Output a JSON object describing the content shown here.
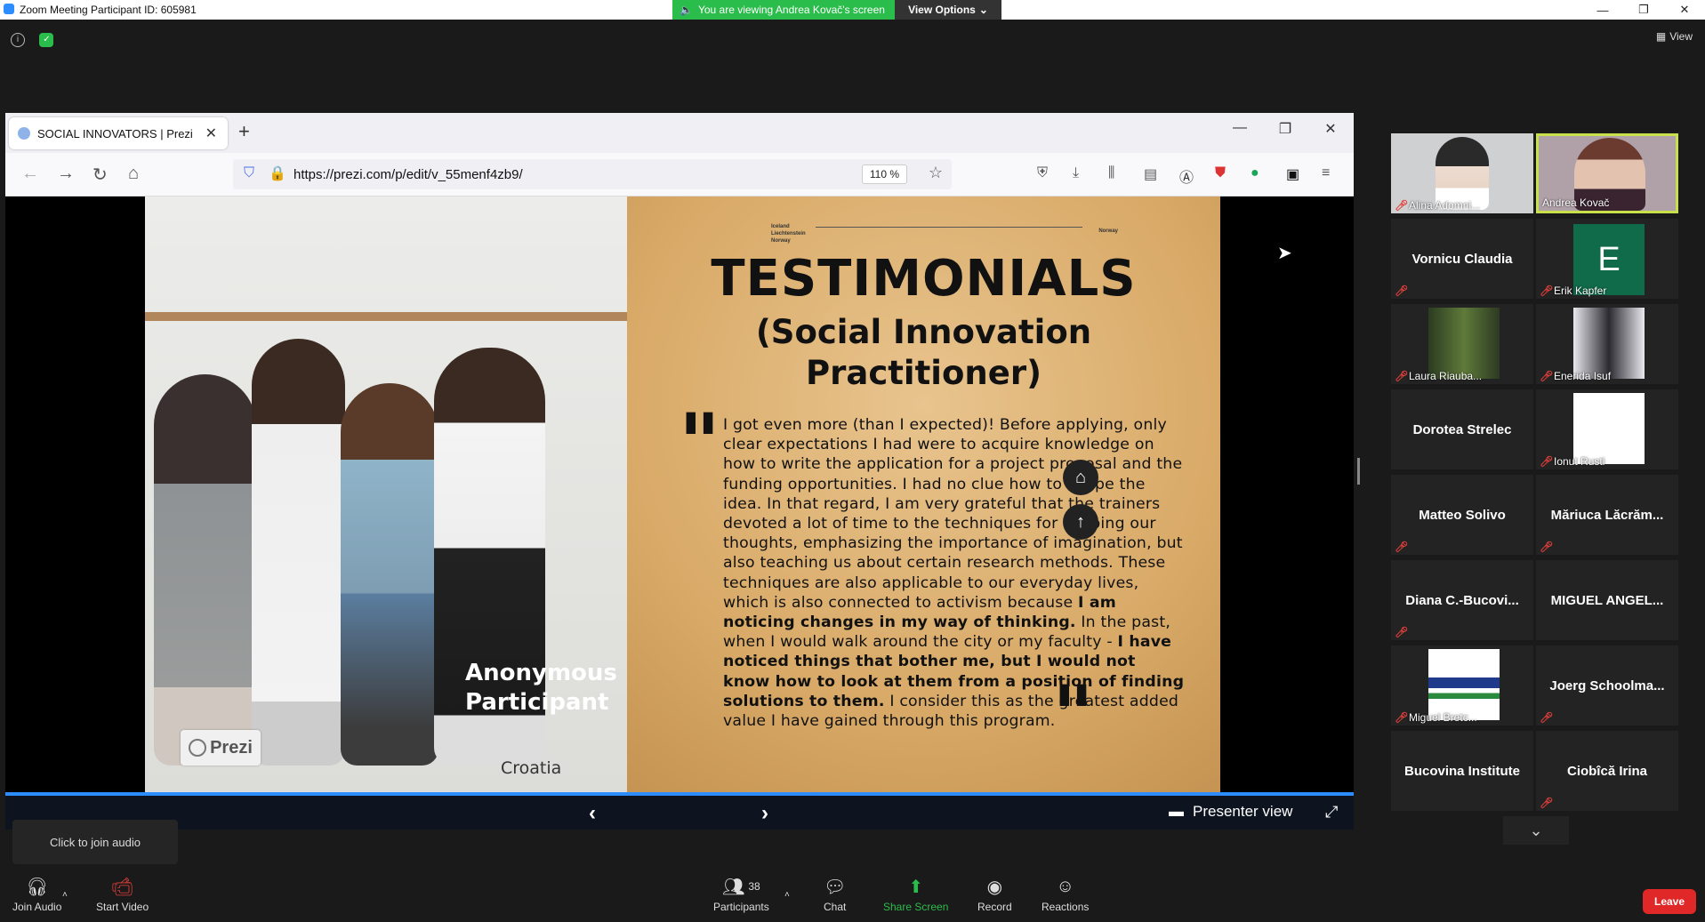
{
  "window": {
    "title": "Zoom Meeting Participant ID: 605981",
    "viewing_banner": "You are viewing Andrea Kovač's screen",
    "view_options": "View Options",
    "view_label": "View"
  },
  "browser": {
    "tab_title": "SOCIAL INNOVATORS | Prezi",
    "url": "https://prezi.com/p/edit/v_55menf4zb9/",
    "zoom": "110 %"
  },
  "slide": {
    "grants_left": "Iceland Liechtenstein Norway",
    "grants_right": "Norway",
    "title": "TESTIMONIALS",
    "subtitle_line1": "(Social Innovation",
    "subtitle_line2": "Practitioner)",
    "quote_part1": "I got even more (than I expected)! Before applying, only clear expectations I had were to acquire knowledge on how to write the application for a project proposal and the funding opportunities. I had no clue how to shape the idea. In that regard, I am very grateful that the trainers devoted a lot of time to the techniques for shaping our thoughts, emphasizing the importance of imagination, but also teaching us about certain research methods. These techniques are also applicable to our everyday lives, which is also connected to activism because ",
    "quote_bold1": "I am noticing changes in my way of thinking.",
    "quote_part2": " In the past, when I would walk around the city or my faculty - ",
    "quote_bold2": "I have noticed things that bother me, but I would not know how to look at them from a position of finding solutions to them.",
    "quote_part3": " I consider this as the greatest added value I have gained through this program.",
    "anonymous_line1": "Anonymous",
    "anonymous_line2": "Participant",
    "country": "Croatia",
    "prezi_logo": "Prezi",
    "presenter_view": "Presenter view"
  },
  "participants": [
    {
      "name": "Alina Adomni...",
      "video": true
    },
    {
      "name": "Andrea Kovač",
      "video": true,
      "active": true
    },
    {
      "name": "Vornicu Claudia"
    },
    {
      "name": "Erik Kapfer",
      "avatar_letter": "E"
    },
    {
      "name": "Laura Riauba...",
      "video": true
    },
    {
      "name": "Enerida Isuf",
      "video": true
    },
    {
      "name": "Dorotea Strelec"
    },
    {
      "name": "Ionut Rusti",
      "video": true
    },
    {
      "name": "Matteo Solivo"
    },
    {
      "name": "Măriuca Lăcrăm..."
    },
    {
      "name": "Diana C.-Bucovi..."
    },
    {
      "name": "MIGUEL ANGEL..."
    },
    {
      "name": "Miguel Bretc...",
      "video": true
    },
    {
      "name": "Joerg Schoolma..."
    },
    {
      "name": "Bucovina Institute"
    },
    {
      "name": "Ciobîcă Irina"
    }
  ],
  "audio_tooltip": "Click to join audio",
  "toolbar": {
    "join_audio": "Join Audio",
    "start_video": "Start Video",
    "participants": "Participants",
    "participants_count": "38",
    "chat": "Chat",
    "share_screen": "Share Screen",
    "record": "Record",
    "reactions": "Reactions",
    "leave": "Leave"
  },
  "colors": {
    "share_green": "#2bbd4b",
    "leave_red": "#e02828",
    "progress_blue": "#2d8cff",
    "active_speaker": "#c8e14a"
  }
}
